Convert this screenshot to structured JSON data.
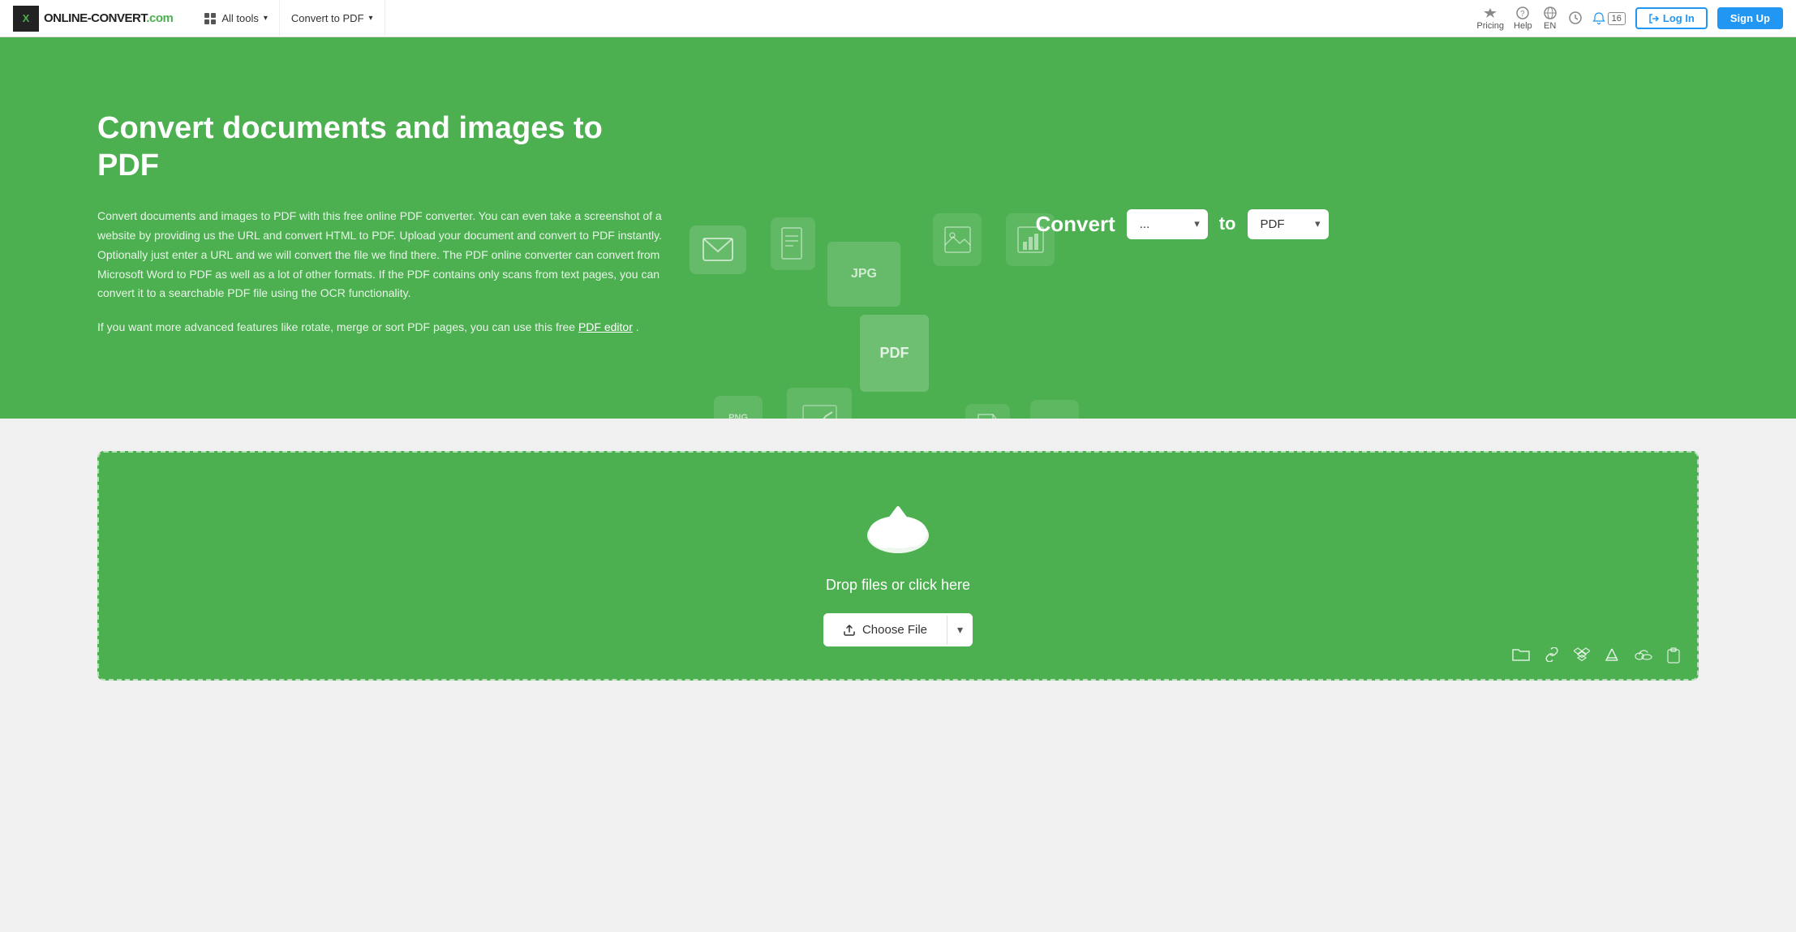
{
  "navbar": {
    "logo_text": "ONLINE-CONVERT",
    "logo_suffix": ".com",
    "all_tools_label": "All tools",
    "convert_to_pdf_label": "Convert to PDF",
    "pricing_label": "Pricing",
    "help_label": "Help",
    "lang_label": "EN",
    "notification_count": "16",
    "login_label": "Log In",
    "signup_label": "Sign Up"
  },
  "hero": {
    "title": "Convert documents and images to PDF",
    "description1": "Convert documents and images to PDF with this free online PDF converter. You can even take a screenshot of a website by providing us the URL and convert HTML to PDF. Upload your document and convert to PDF instantly. Optionally just enter a URL and we will convert the file we find there. The PDF online converter can convert from Microsoft Word to PDF as well as a lot of other formats. If the PDF contains only scans from text pages, you can convert it to a searchable PDF file using the OCR functionality.",
    "description2": "If you want more advanced features like rotate, merge or sort PDF pages, you can use this free",
    "pdf_editor_link": "PDF editor",
    "description2_end": ".",
    "convert_label": "Convert",
    "from_placeholder": "...",
    "to_label": "to",
    "to_value": "PDF"
  },
  "upload": {
    "drop_text": "Drop files or click here",
    "choose_file_label": "Choose File",
    "dropdown_arrow": "▾"
  }
}
